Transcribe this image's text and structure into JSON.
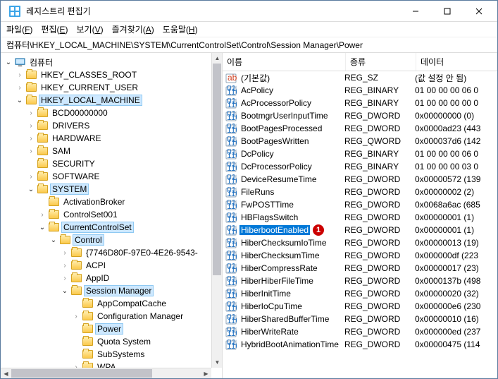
{
  "window": {
    "title": "레지스트리 편집기"
  },
  "menu": {
    "file": "파일(",
    "file_u": "F",
    "file_end": ")",
    "edit": "편집(",
    "edit_u": "E",
    "edit_end": ")",
    "view": "보기(",
    "view_u": "V",
    "view_end": ")",
    "fav": "즐겨찾기(",
    "fav_u": "A",
    "fav_end": ")",
    "help": "도움말(",
    "help_u": "H",
    "help_end": ")"
  },
  "address": "컴퓨터\\HKEY_LOCAL_MACHINE\\SYSTEM\\CurrentControlSet\\Control\\Session Manager\\Power",
  "tree": {
    "root": "컴퓨터",
    "hkcr": "HKEY_CLASSES_ROOT",
    "hkcu": "HKEY_CURRENT_USER",
    "hklm": "HKEY_LOCAL_MACHINE",
    "bcd": "BCD00000000",
    "drivers": "DRIVERS",
    "hardware": "HARDWARE",
    "sam": "SAM",
    "security": "SECURITY",
    "software": "SOFTWARE",
    "system": "SYSTEM",
    "activationbroker": "ActivationBroker",
    "controlset001": "ControlSet001",
    "currentcontrolset": "CurrentControlSet",
    "control": "Control",
    "guid": "{7746D80F-97E0-4E26-9543-",
    "acpi": "ACPI",
    "appid": "AppID",
    "sessionmanager": "Session Manager",
    "appcompatcache": "AppCompatCache",
    "configurationmanager": "Configuration Manager",
    "power": "Power",
    "quotasystem": "Quota System",
    "subsystems": "SubSystems",
    "wpa": "WPA"
  },
  "columns": {
    "name": "이름",
    "type": "종류",
    "data": "데이터"
  },
  "badge_text": "1",
  "values": [
    {
      "icon": "sz",
      "name": "(기본값)",
      "type": "REG_SZ",
      "data": "(값 설정 안 됨)"
    },
    {
      "icon": "bin",
      "name": "AcPolicy",
      "type": "REG_BINARY",
      "data": "01 00 00 00 06 0"
    },
    {
      "icon": "bin",
      "name": "AcProcessorPolicy",
      "type": "REG_BINARY",
      "data": "01 00 00 00 00 0"
    },
    {
      "icon": "bin",
      "name": "BootmgrUserInputTime",
      "type": "REG_DWORD",
      "data": "0x00000000 (0)"
    },
    {
      "icon": "bin",
      "name": "BootPagesProcessed",
      "type": "REG_DWORD",
      "data": "0x0000ad23 (443"
    },
    {
      "icon": "bin",
      "name": "BootPagesWritten",
      "type": "REG_QWORD",
      "data": "0x000037d6 (142"
    },
    {
      "icon": "bin",
      "name": "DcPolicy",
      "type": "REG_BINARY",
      "data": "01 00 00 00 06 0"
    },
    {
      "icon": "bin",
      "name": "DcProcessorPolicy",
      "type": "REG_BINARY",
      "data": "01 00 00 00 03 0"
    },
    {
      "icon": "bin",
      "name": "DeviceResumeTime",
      "type": "REG_DWORD",
      "data": "0x00000572 (139"
    },
    {
      "icon": "bin",
      "name": "FileRuns",
      "type": "REG_DWORD",
      "data": "0x00000002 (2)"
    },
    {
      "icon": "bin",
      "name": "FwPOSTTime",
      "type": "REG_DWORD",
      "data": "0x0068a6ac (685"
    },
    {
      "icon": "bin",
      "name": "HBFlagsSwitch",
      "type": "REG_DWORD",
      "data": "0x00000001 (1)"
    },
    {
      "icon": "bin",
      "name": "HiberbootEnabled",
      "type": "REG_DWORD",
      "data": "0x00000001 (1)",
      "selected": true,
      "badge": true
    },
    {
      "icon": "bin",
      "name": "HiberChecksumIoTime",
      "type": "REG_DWORD",
      "data": "0x00000013 (19)"
    },
    {
      "icon": "bin",
      "name": "HiberChecksumTime",
      "type": "REG_DWORD",
      "data": "0x000000df (223"
    },
    {
      "icon": "bin",
      "name": "HiberCompressRate",
      "type": "REG_DWORD",
      "data": "0x00000017 (23)"
    },
    {
      "icon": "bin",
      "name": "HiberHiberFileTime",
      "type": "REG_DWORD",
      "data": "0x0000137b (498"
    },
    {
      "icon": "bin",
      "name": "HiberInitTime",
      "type": "REG_DWORD",
      "data": "0x00000020 (32)"
    },
    {
      "icon": "bin",
      "name": "HiberIoCpuTime",
      "type": "REG_DWORD",
      "data": "0x000000e6 (230"
    },
    {
      "icon": "bin",
      "name": "HiberSharedBufferTime",
      "type": "REG_DWORD",
      "data": "0x00000010 (16)"
    },
    {
      "icon": "bin",
      "name": "HiberWriteRate",
      "type": "REG_DWORD",
      "data": "0x000000ed (237"
    },
    {
      "icon": "bin",
      "name": "HybridBootAnimationTime",
      "type": "REG_DWORD",
      "data": "0x00000475 (114"
    }
  ]
}
